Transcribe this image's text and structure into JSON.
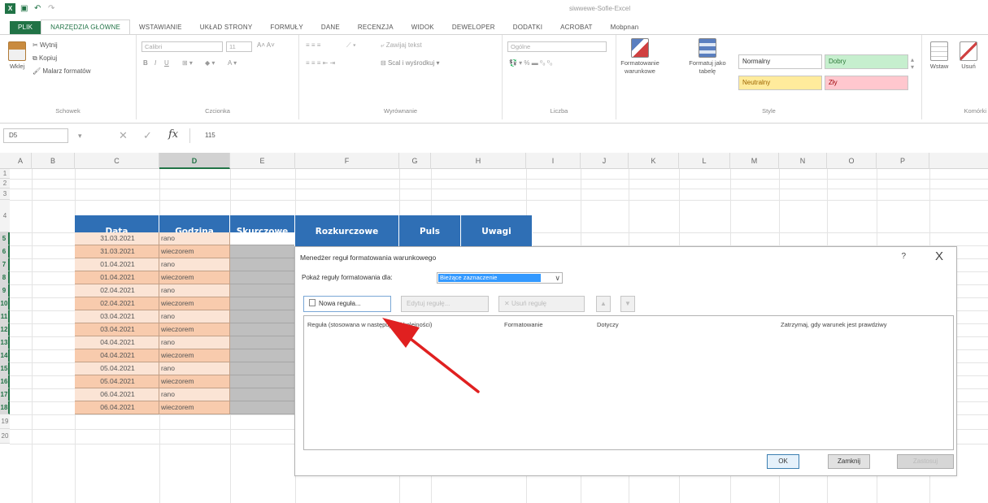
{
  "window": {
    "title": "siwwewe-Sofie-Excel"
  },
  "tabs": [
    "PLIK",
    "NARZĘDZIA GŁÓWNE",
    "WSTAWIANIE",
    "UKŁAD STRONY",
    "FORMUŁY",
    "DANE",
    "RECENZJA",
    "WIDOK",
    "DEWELOPER",
    "DODATKI",
    "ACROBAT",
    "Mobpnan"
  ],
  "ribbon": {
    "clipboard": {
      "label": "Schowek",
      "paste": "Wklej",
      "cut": "Wytnij",
      "copy": "Kopiuj",
      "painter": "Malarz formatów"
    },
    "font": {
      "label": "Czcionka",
      "name": "Calibri",
      "size": "11"
    },
    "alignment": {
      "label": "Wyrównanie",
      "wrap": "Zawijaj tekst",
      "merge": "Scal i wyśrodkuj"
    },
    "number": {
      "label": "Liczba",
      "format": "Ogólne"
    },
    "styles": {
      "label": "Style",
      "conditional": "Formatowanie warunkowe",
      "as_table": "Formatuj jako tabelę",
      "normal": "Normalny",
      "good": "Dobry",
      "neutral": "Neutralny",
      "bad": "Zły"
    },
    "cells": {
      "insert": "Wstaw",
      "delete": "Usuń",
      "label": "Komórki"
    }
  },
  "formula_bar": {
    "name_box": "D5",
    "fx": "fx",
    "value": "115"
  },
  "columns": [
    "A",
    "B",
    "C",
    "D",
    "E",
    "F",
    "G",
    "H",
    "I",
    "J",
    "K",
    "L",
    "M",
    "N",
    "O",
    "P"
  ],
  "rows": [
    "1",
    "2",
    "3",
    "4",
    "5",
    "6",
    "7",
    "8",
    "9",
    "10",
    "11",
    "12",
    "13",
    "14",
    "15",
    "16",
    "17",
    "18",
    "19",
    "20"
  ],
  "table": {
    "headers": [
      "Data",
      "Godzina",
      "Skurczowe",
      "Rozkurczowe",
      "Puls",
      "Uwagi"
    ],
    "rows": [
      {
        "date": "31.03.2021",
        "time": "rano"
      },
      {
        "date": "31.03.2021",
        "time": "wieczorem"
      },
      {
        "date": "01.04.2021",
        "time": "rano"
      },
      {
        "date": "01.04.2021",
        "time": "wieczorem"
      },
      {
        "date": "02.04.2021",
        "time": "rano"
      },
      {
        "date": "02.04.2021",
        "time": "wieczorem"
      },
      {
        "date": "03.04.2021",
        "time": "rano"
      },
      {
        "date": "03.04.2021",
        "time": "wieczorem"
      },
      {
        "date": "04.04.2021",
        "time": "rano"
      },
      {
        "date": "04.04.2021",
        "time": "wieczorem"
      },
      {
        "date": "05.04.2021",
        "time": "rano"
      },
      {
        "date": "05.04.2021",
        "time": "wieczorem"
      },
      {
        "date": "06.04.2021",
        "time": "rano"
      },
      {
        "date": "06.04.2021",
        "time": "wieczorem"
      }
    ]
  },
  "dialog": {
    "title": "Menedżer reguł formatowania warunkowego",
    "help": "?",
    "close": "X",
    "show_label": "Pokaż reguły formatowania dla:",
    "show_value": "Bieżące zaznaczenie",
    "new_rule": "Nowa reguła...",
    "edit_rule": "Edytuj regułę...",
    "delete_rule": "Usuń regułę",
    "columns": [
      "Reguła (stosowana w następującej kolejności)",
      "Formatowanie",
      "Dotyczy",
      "Zatrzymaj, gdy warunek jest prawdziwy"
    ],
    "ok": "OK",
    "close_btn": "Zamknij",
    "apply": "Zastosuj"
  },
  "colors": {
    "accent": "#217346",
    "table_header": "#2f6fb5",
    "row_light": "#fbe4d5",
    "row_dark": "#f8cbad",
    "arrow": "#e02020"
  }
}
